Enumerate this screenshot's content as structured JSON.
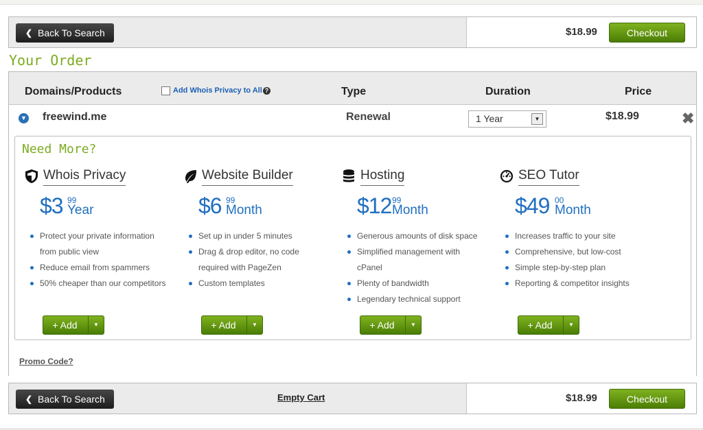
{
  "top_bar": {
    "back_label": "Back To Search",
    "total": "$18.99",
    "checkout_label": "Checkout"
  },
  "your_order_heading": "Your Order",
  "table": {
    "headers": {
      "domains": "Domains/Products",
      "whois_privacy": "Add Whois Privacy to All",
      "type": "Type",
      "duration": "Duration",
      "price": "Price"
    },
    "row": {
      "domain": "freewind.me",
      "type": "Renewal",
      "duration": "1 Year",
      "price": "$18.99"
    }
  },
  "upsell": {
    "heading": "Need More?",
    "products": [
      {
        "icon": "shield-icon",
        "title": "Whois Privacy",
        "price_main": "$3",
        "price_cents": "99",
        "price_per": "Year",
        "features": [
          "Protect your private information",
          "from public view",
          "Reduce email from spammers",
          "50% cheaper than our competitors"
        ],
        "add_label": "+ Add"
      },
      {
        "icon": "leaf-icon",
        "title": "Website Builder",
        "price_main": "$6",
        "price_cents": "99",
        "price_per": "Month",
        "features": [
          "Set up in under 5 minutes",
          "Drag & drop editor, no code",
          "required with PageZen",
          "Custom templates"
        ],
        "add_label": "+ Add"
      },
      {
        "icon": "database-icon",
        "title": "Hosting",
        "price_main": "$12",
        "price_cents": "99",
        "price_per": "Month",
        "features": [
          "Generous amounts of disk space",
          "Simplified management with",
          "cPanel",
          "Plenty of bandwidth",
          "Legendary technical support"
        ],
        "add_label": "+ Add"
      },
      {
        "icon": "gauge-icon",
        "title": "SEO Tutor",
        "price_main": "$49",
        "price_cents": "00",
        "price_per": "Month",
        "features": [
          "Increases traffic to your site",
          "Comprehensive, but low-cost",
          "Simple step-by-step plan",
          "Reporting & competitor insights"
        ],
        "add_label": "+ Add"
      }
    ]
  },
  "promo_label": "Promo Code?",
  "bottom_bar": {
    "back_label": "Back To Search",
    "empty_cart_label": "Empty Cart",
    "total": "$18.99",
    "checkout_label": "Checkout"
  },
  "colors": {
    "accent_green": "#6a9a12",
    "link_blue": "#1a5fb4",
    "price_blue": "#1f6fc0"
  }
}
